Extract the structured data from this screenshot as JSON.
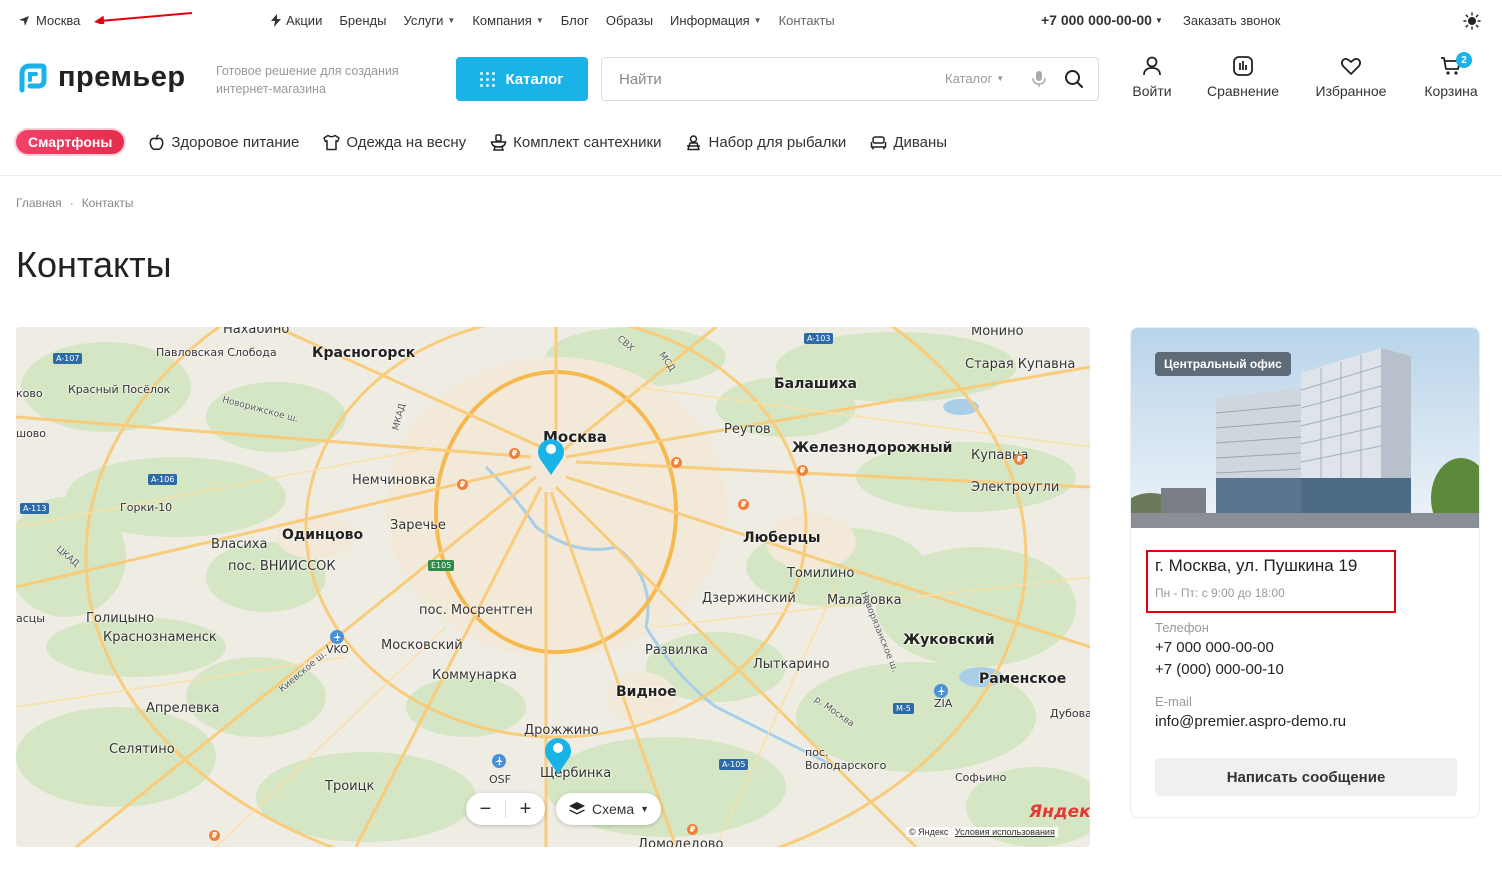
{
  "topbar": {
    "city": "Москва",
    "nav": [
      {
        "label": "Акции",
        "icon": "lightning-icon",
        "dropdown": false
      },
      {
        "label": "Бренды",
        "dropdown": false
      },
      {
        "label": "Услуги",
        "dropdown": true
      },
      {
        "label": "Компания",
        "dropdown": true
      },
      {
        "label": "Блог",
        "dropdown": false
      },
      {
        "label": "Образы",
        "dropdown": false
      },
      {
        "label": "Информация",
        "dropdown": true
      },
      {
        "label": "Контакты",
        "dropdown": false,
        "active": true
      }
    ],
    "phone": "+7 000 000-00-00",
    "callback": "Заказать звонок"
  },
  "header": {
    "logo_text": "премьер",
    "tagline": "Готовое решение для создания интернет-магазина",
    "catalog_button": "Каталог",
    "search": {
      "placeholder": "Найти",
      "scope": "Каталог"
    },
    "actions": {
      "login": "Войти",
      "compare": "Сравнение",
      "favorites": "Избранное",
      "cart": "Корзина",
      "cart_count": "2"
    },
    "accent_color": "#1ab3e8"
  },
  "categories": {
    "highlight": "Смартфоны",
    "items": [
      {
        "label": "Здоровое питание",
        "icon": "apple-icon"
      },
      {
        "label": "Одежда на весну",
        "icon": "tshirt-icon"
      },
      {
        "label": "Комплект сантехники",
        "icon": "toilet-icon"
      },
      {
        "label": "Набор для рыбалки",
        "icon": "fishing-icon"
      },
      {
        "label": "Диваны",
        "icon": "sofa-icon"
      }
    ]
  },
  "breadcrumb": {
    "home": "Главная",
    "current": "Контакты"
  },
  "page_title": "Контакты",
  "map": {
    "places": {
      "p1": "Нахабино",
      "p2": "Красногорск",
      "p3": "Павловская Слобода",
      "p4": "Красный Посёлок",
      "p5": "Новорижское ш.",
      "p6": "Москва",
      "p7": "Балашиха",
      "p8": "Реутов",
      "p9": "Железнодорожный",
      "p10": "Купавна",
      "p11": "Электроугли",
      "p12": "Немчиновка",
      "p13": "Горки-10",
      "p14": "Одинцово",
      "p15": "Заречье",
      "p16": "Власиха",
      "p17": "пос. ВНИИССОК",
      "p18": "Люберцы",
      "p19": "Томилино",
      "p20": "Дзержинский",
      "p21": "Малаховка",
      "p22": "пос. Мосрентген",
      "p23": "Голицыно",
      "p24": "Краснознаменск",
      "p25": "Московский",
      "p26": "Развилка",
      "p27": "Жуковский",
      "p28": "Лыткарино",
      "p29": "Коммунарка",
      "p30": "Раменское",
      "p31": "Видное",
      "p32": "Апрелевка",
      "p33": "Дрожжино",
      "p34": "Селятино",
      "p35": "Щербинка",
      "p36": "пос. Володарского",
      "p37": "Софьино",
      "p38": "Троицк",
      "p39": "Домодедово",
      "p40": "Монино",
      "p41": "Старая Купавна",
      "p42": "Дубовая",
      "p43": "Киевское ш.",
      "p44": "Новорязанское ш.",
      "p45": "МКАД",
      "p46": "МСД",
      "p47": "ЦКАД",
      "p48": "р. Москва",
      "p49": "СВХ",
      "p50": "шово",
      "p51": "асцы",
      "p52": "ково"
    },
    "shields": {
      "s1": "A-107",
      "s2": "A-106",
      "s3": "A-113",
      "s4": "E105",
      "s5": "A-103",
      "s6": "M-5",
      "s7": "A-105"
    },
    "airports": {
      "a1": "VKO",
      "a2": "ZIA",
      "a3": "OSF"
    },
    "zoom_out": "−",
    "zoom_in": "+",
    "layers_label": "Схема",
    "yandex_logo": "Яндекс",
    "copyright": "© Яндекс",
    "terms": "Условия использования"
  },
  "office": {
    "tag": "Центральный офис",
    "address": "г. Москва, ул. Пушкина 19",
    "hours": "Пн - Пт: с 9:00 до 18:00",
    "phone_label": "Телефон",
    "phones": [
      "+7 000 000-00-00",
      "+7 (000) 000-00-10"
    ],
    "email_label": "E-mail",
    "email": "info@premier.aspro-demo.ru",
    "message_button": "Написать сообщение"
  }
}
